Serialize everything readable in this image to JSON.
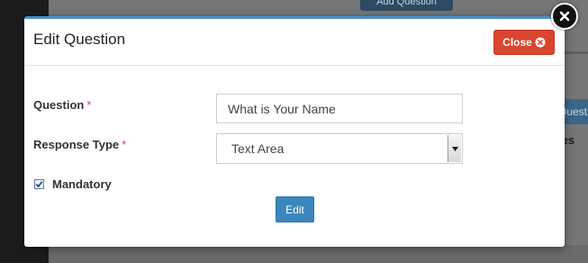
{
  "background": {
    "top_button_label": "Add Question",
    "right_button_label": "Questi",
    "right_text": "ies"
  },
  "modal": {
    "title": "Edit Question",
    "close_label": "Close",
    "question_label": "Question",
    "question_value": "What is Your Name",
    "response_type_label": "Response Type",
    "response_type_value": "Text Area",
    "required_marker": "*",
    "mandatory_label": "Mandatory",
    "mandatory_checked": true,
    "edit_label": "Edit"
  },
  "colors": {
    "close_button": "#d9452f",
    "edit_button": "#3b87bd",
    "header_accent": "#4a90c8"
  },
  "icons": {
    "close_button_icon": "circle-x-icon",
    "dismiss_icon": "close-circle-icon",
    "select_arrow": "chevron-down-icon",
    "checkbox": "checkmark-icon"
  }
}
